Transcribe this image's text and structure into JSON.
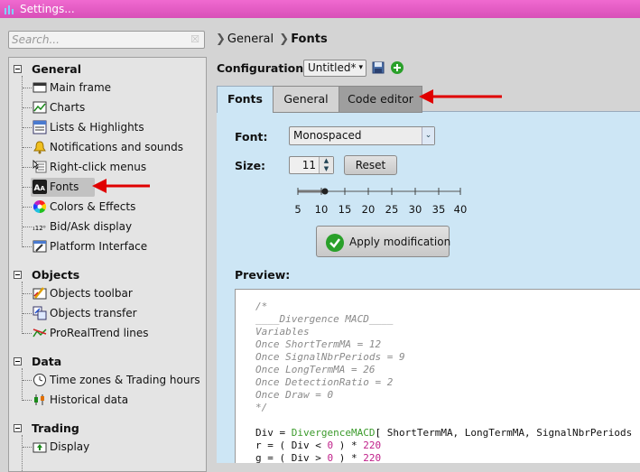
{
  "window": {
    "title": "Settings..."
  },
  "search": {
    "placeholder": "Search...",
    "clear_label": "☒"
  },
  "tree": {
    "groups": [
      {
        "label": "General",
        "items": [
          "Main frame",
          "Charts",
          "Lists & Highlights",
          "Notifications and sounds",
          "Right-click menus",
          "Fonts",
          "Colors & Effects",
          "Bid/Ask display",
          "Platform Interface"
        ]
      },
      {
        "label": "Objects",
        "items": [
          "Objects toolbar",
          "Objects transfer",
          "ProRealTrend lines"
        ]
      },
      {
        "label": "Data",
        "items": [
          "Time zones & Trading hours",
          "Historical data"
        ]
      },
      {
        "label": "Trading",
        "items": [
          "Display"
        ]
      }
    ],
    "selected": "Fonts"
  },
  "breadcrumb": {
    "part1": "General",
    "part2": "Fonts"
  },
  "config": {
    "label": "Configuration:",
    "value": "Untitled*"
  },
  "tabs": {
    "fonts": "Fonts",
    "general": "General",
    "code_editor": "Code editor"
  },
  "font_settings": {
    "font_label": "Font:",
    "font_value": "Monospaced",
    "size_label": "Size:",
    "size_value": "11",
    "reset_label": "Reset",
    "slider_ticks": [
      "5",
      "10",
      "15",
      "20",
      "25",
      "30",
      "35",
      "40"
    ],
    "apply_label": "Apply modification",
    "preview_label": "Preview:"
  },
  "preview_code": {
    "c1": "/*",
    "c2": "____Divergence MACD____",
    "c3": "Variables",
    "c4": "Once ShortTermMA = 12",
    "c5": "Once SignalNbrPeriods = 9",
    "c6": "Once LongTermMA = 26",
    "c7": "Once DetectionRatio = 2",
    "c8": "Once Draw = 0",
    "c9": "*/",
    "l1a": "Div = ",
    "l1fn": "DivergenceMACD",
    "l1b": "[ ShortTermMA, LongTermMA, SignalNbrPeriods",
    "l2a": "r = ( Div < ",
    "l2n1": "0",
    "l2b": " ) * ",
    "l2n2": "220",
    "l3a": "g = ( Div > ",
    "l3n1": "0",
    "l3b": " ) * ",
    "l3n2": "220"
  },
  "colors": {
    "titlebar": "#e05cc4",
    "panel": "#cde6f5",
    "accent_arrow": "#e00000"
  }
}
